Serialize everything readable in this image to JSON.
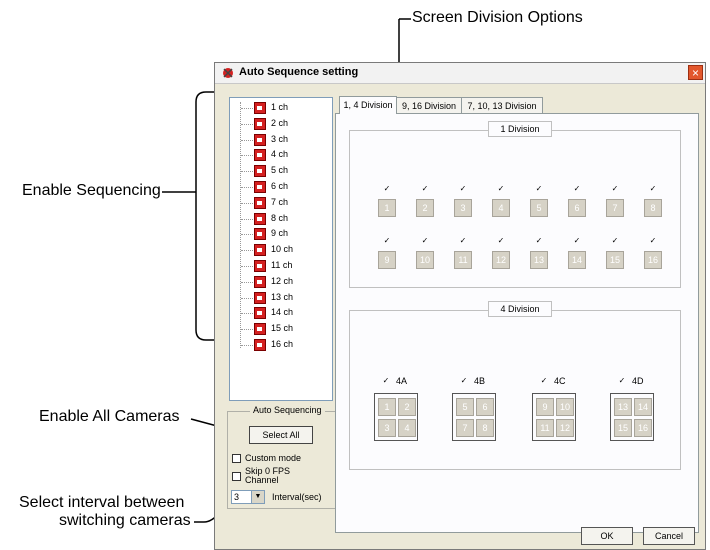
{
  "callouts": {
    "screen_division": "Screen Division Options",
    "enable_sequencing": "Enable Sequencing",
    "enable_all": "Enable All Cameras",
    "select_interval_1": "Select interval between",
    "select_interval_2": "switching cameras"
  },
  "window": {
    "title": "Auto Sequence setting",
    "close": "×"
  },
  "channels": [
    "1 ch",
    "2 ch",
    "3 ch",
    "4 ch",
    "5 ch",
    "6 ch",
    "7 ch",
    "8 ch",
    "9 ch",
    "10 ch",
    "11 ch",
    "12 ch",
    "13 ch",
    "14 ch",
    "15 ch",
    "16 ch"
  ],
  "auto_sequencing": {
    "legend": "Auto Sequencing",
    "select_all": "Select All",
    "custom_mode": "Custom mode",
    "skip_fps_1": "Skip 0 FPS",
    "skip_fps_2": "Channel",
    "interval_value": "3",
    "interval_label": "Interval(sec)"
  },
  "tabs": [
    "1, 4 Division",
    "9, 16 Division",
    "7, 10, 13 Division"
  ],
  "division1": {
    "label": "1 Division",
    "row1": [
      "1",
      "2",
      "3",
      "4",
      "5",
      "6",
      "7",
      "8"
    ],
    "row2": [
      "9",
      "10",
      "11",
      "12",
      "13",
      "14",
      "15",
      "16"
    ]
  },
  "division4": {
    "label": "4 Division",
    "quads": [
      {
        "name": "4A",
        "cells": [
          "1",
          "2",
          "3",
          "4"
        ]
      },
      {
        "name": "4B",
        "cells": [
          "5",
          "6",
          "7",
          "8"
        ]
      },
      {
        "name": "4C",
        "cells": [
          "9",
          "10",
          "11",
          "12"
        ]
      },
      {
        "name": "4D",
        "cells": [
          "13",
          "14",
          "15",
          "16"
        ]
      }
    ]
  },
  "buttons": {
    "ok": "OK",
    "cancel": "Cancel"
  },
  "check_mark": "✓",
  "colors": {
    "dialog_bg": "#ece9d8",
    "camera_icon": "#d42020",
    "close_button": "#e2572c"
  }
}
